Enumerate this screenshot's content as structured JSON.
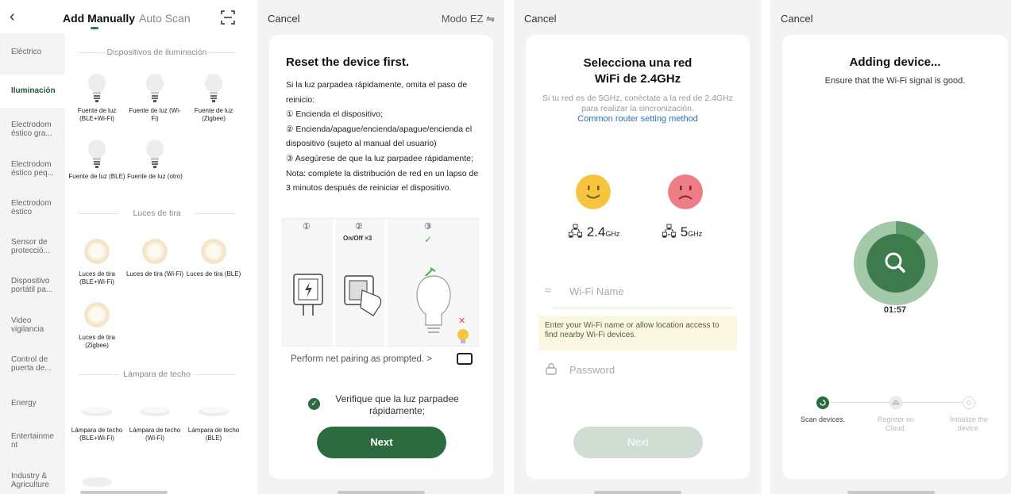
{
  "screen1": {
    "tabs": {
      "active": "Add Manually",
      "inactive": "Auto Scan"
    },
    "sidebar": [
      "Eléctrico",
      "Iluminación",
      "Electrodom éstico gra...",
      "Electrodom éstico peq...",
      "Electrodom éstico",
      "Sensor de protecció...",
      "Dispositivo portátil pa...",
      "Video vigilancia",
      "Control de puerta de...",
      "Energy",
      "Entertainme nt",
      "Industry & Agriculture"
    ],
    "sections": {
      "lighting": "Dispositivos de iluminación",
      "strips": "Luces de tira",
      "ceiling": "Lámpara de techo"
    },
    "lighting_devices": [
      "Fuente de luz (BLE+Wi-Fi)",
      "Fuente de luz (Wi-Fi)",
      "Fuente de luz (Zigbee)",
      "Fuente de luz (BLE)",
      "Fuente de luz (otro)"
    ],
    "strip_devices": [
      "Luces de tira (BLE+Wi-Fi)",
      "Luces de tira (Wi-Fi)",
      "Luces de tira (BLE)",
      "Luces de tira (Zigbee)"
    ],
    "ceiling_devices": [
      "Lámpara de techo (BLE+Wi-Fi)",
      "Lámpara de techo (Wi-Fi)",
      "Lámpara de techo (BLE)"
    ]
  },
  "screen2": {
    "cancel": "Cancel",
    "mode": "Modo EZ ⇋",
    "title": "Reset the device first.",
    "steps": [
      "Si la luz parpadea rápidamente, omita el paso de reinicio:",
      "① Encienda el dispositivo;",
      "② Encienda/apague/encienda/apague/encienda el dispositivo (sujeto al manual del usuario)",
      "③ Asegúrese de que la luz parpadee rápidamente;",
      "Nota: complete la distribución de red en un lapso de 3 minutos después de reiniciar el dispositivo."
    ],
    "illus": {
      "n1": "①",
      "n2": "②",
      "n3": "③",
      "onoff": "On/Off ×3"
    },
    "pair_prompt": "Perform net pairing as prompted. >",
    "verify": "Verifique que la luz parpadee rápidamente;",
    "next": "Next"
  },
  "screen3": {
    "cancel": "Cancel",
    "title": "Selecciona una red WiFi de 2.4GHz",
    "hint": "Si tu red es de 5GHz, conéctate a la red de 2.4GHz para realizar la sincronización.",
    "link": "Common router setting method",
    "band_ok": "2.4",
    "band_bad": "5",
    "ghz": "GHz",
    "wifi_placeholder": "Wi-Fi Name",
    "warning": "Enter your Wi-Fi name or allow location access to find nearby Wi-Fi devices.",
    "password_placeholder": "Password",
    "next": "Next"
  },
  "screen4": {
    "cancel": "Cancel",
    "title": "Adding device...",
    "subtitle": "Ensure that the Wi-Fi signal is good.",
    "timer": "01:57",
    "progress": 0.12,
    "steps": [
      "Scan devices.",
      "Register on Cloud.",
      "Initialize the device."
    ]
  },
  "colors": {
    "primary": "#2c6b40",
    "disabled": "#cfddd3",
    "link": "#2c6fb5",
    "smile": "#f7c43f",
    "sad": "#ef7d86"
  }
}
